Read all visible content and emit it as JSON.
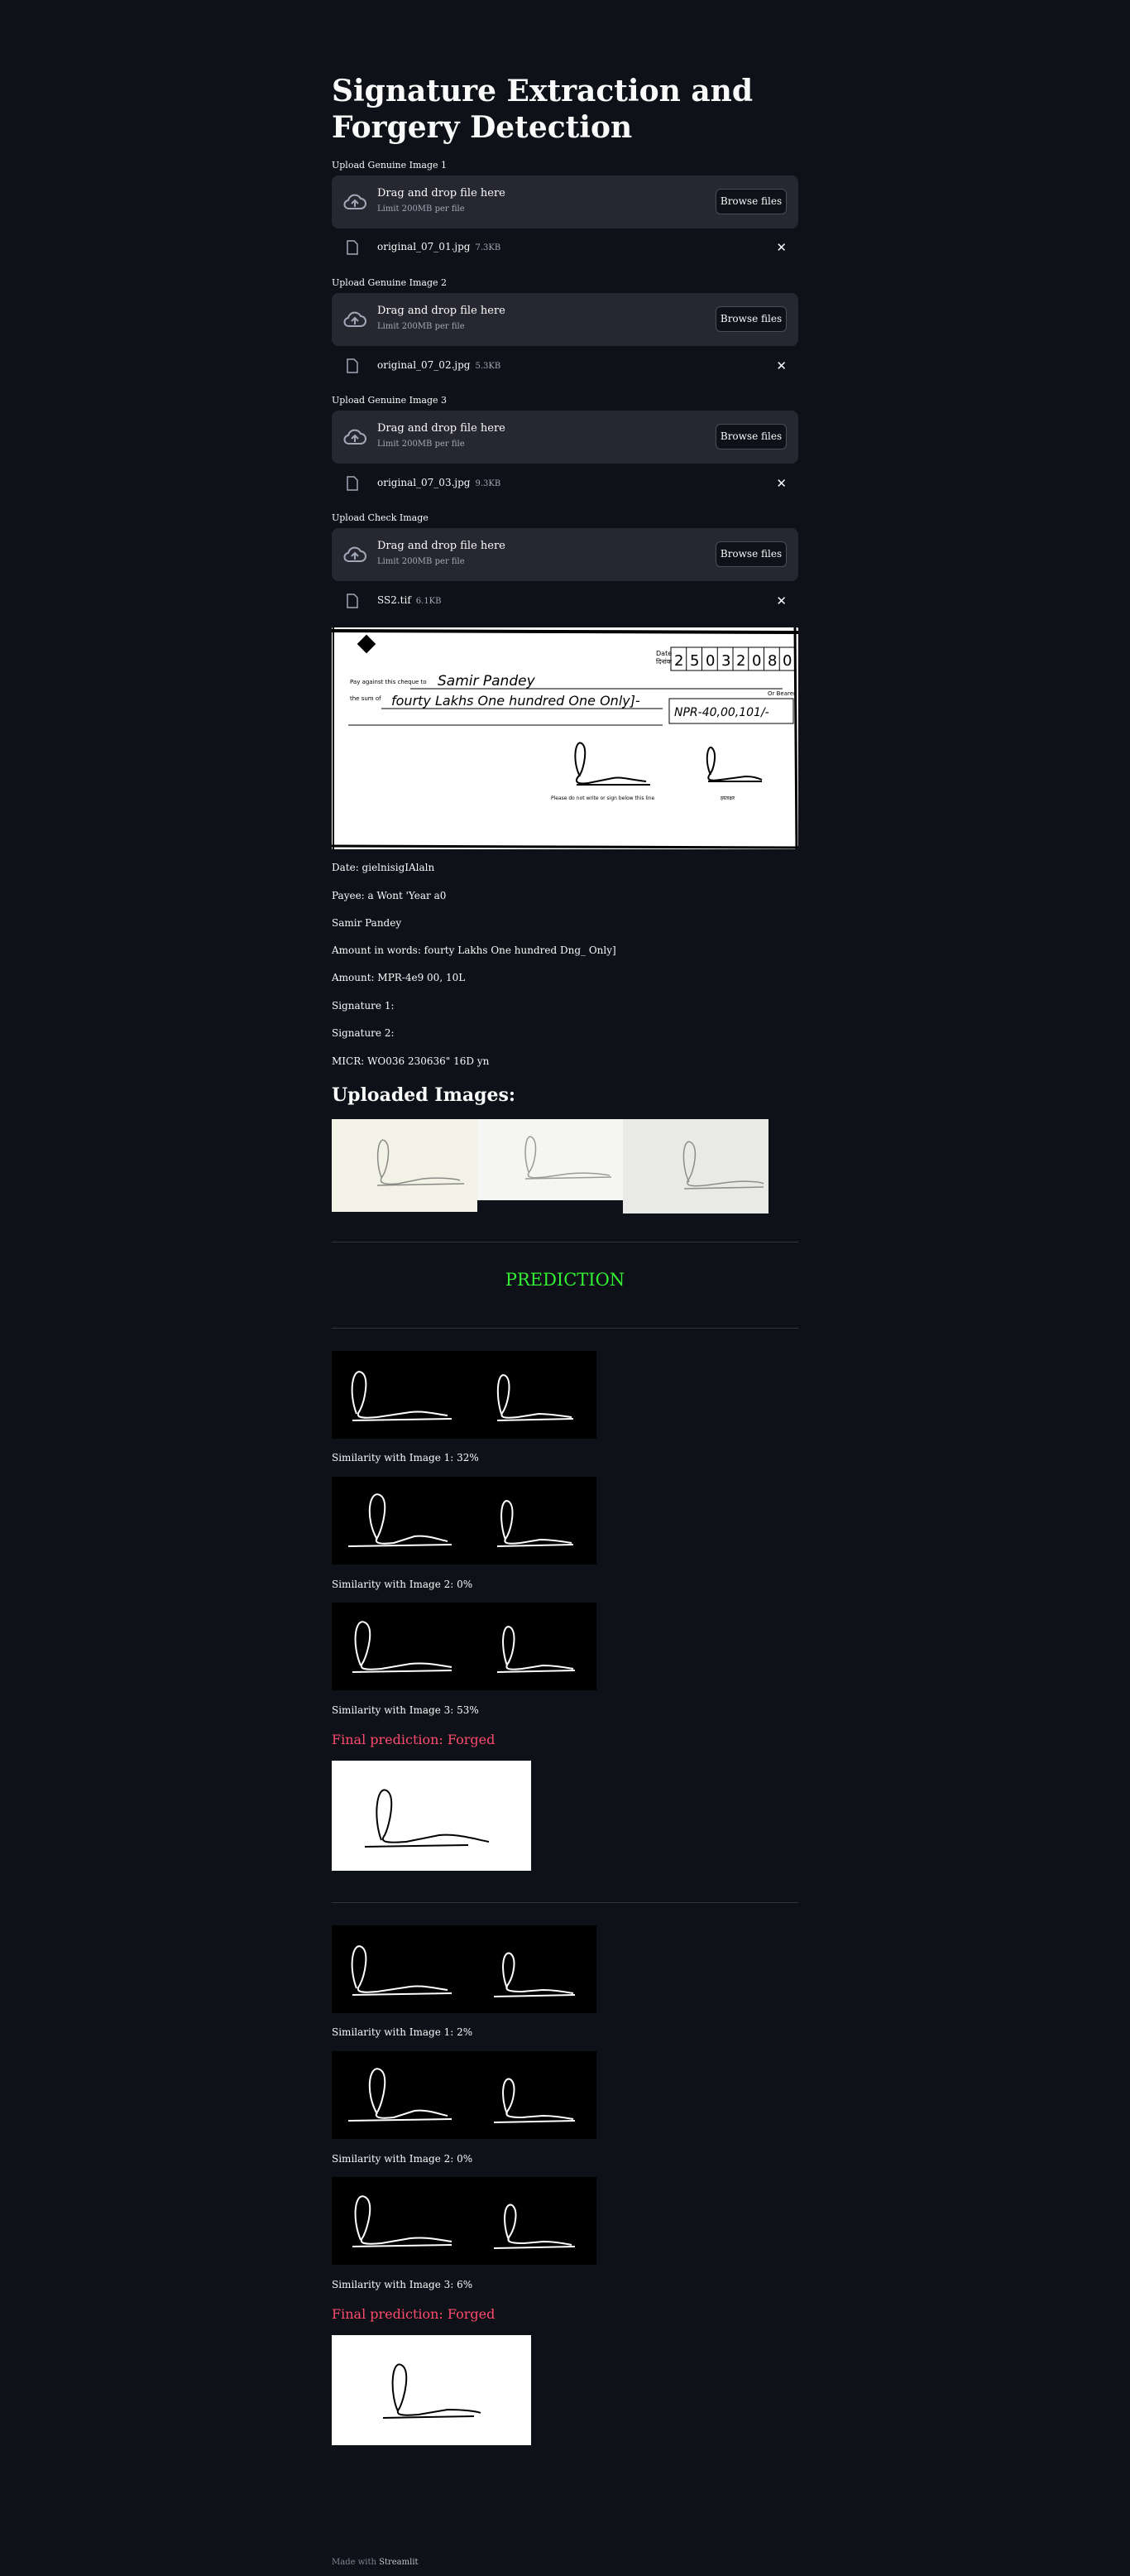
{
  "app": {
    "title": "Signature Extraction and Forgery Detection"
  },
  "uploaders": [
    {
      "label": "Upload Genuine Image 1",
      "drop_text": "Drag and drop file here",
      "limit": "Limit 200MB per file",
      "button": "Browse files",
      "file_name": "original_07_01.jpg",
      "file_size": "7.3KB"
    },
    {
      "label": "Upload Genuine Image 2",
      "drop_text": "Drag and drop file here",
      "limit": "Limit 200MB per file",
      "button": "Browse files",
      "file_name": "original_07_02.jpg",
      "file_size": "5.3KB"
    },
    {
      "label": "Upload Genuine Image 3",
      "drop_text": "Drag and drop file here",
      "limit": "Limit 200MB per file",
      "button": "Browse files",
      "file_name": "original_07_03.jpg",
      "file_size": "9.3KB"
    },
    {
      "label": "Upload Check Image",
      "drop_text": "Drag and drop file here",
      "limit": "Limit 200MB per file",
      "button": "Browse files",
      "file_name": "SS2.tif",
      "file_size": "6.1KB"
    }
  ],
  "cheque": {
    "date_label_1": "Date",
    "date_label_2": "दिनांक",
    "date_digits": [
      "2",
      "5",
      "0",
      "3",
      "2",
      "0",
      "8",
      "0"
    ],
    "pay_line": "Pay against this cheque to",
    "payee_handwritten": "Samir Pandey",
    "or_bearer": "Or Bearer",
    "sum_label": "the sum of",
    "sum_handwritten": "fourty Lakhs One hundred One Only]-",
    "amount_box": "NPR-40,00,101/-",
    "sign_note_1": "Please do not write or sign below this line",
    "sign_note_2": "हस्ताक्षर"
  },
  "extracted": {
    "date": "Date: gielnisigIAlaln",
    "payee": "Payee: a Wont 'Year a0",
    "name": "Samir Pandey",
    "amount_words": "Amount in words: fourty Lakhs One hundred Dng_ Only]",
    "amount": "Amount: MPR-4e9 00, 10L",
    "signature1": "Signature 1:",
    "signature2": "Signature 2:",
    "micr": "MICR: WO036 230636\" 16D yn"
  },
  "uploaded_heading": "Uploaded Images:",
  "prediction_heading": "PREDICTION",
  "results": [
    {
      "sims": [
        "Similarity with Image 1: 32%",
        "Similarity with Image 2: 0%",
        "Similarity with Image 3: 53%"
      ],
      "final": "Final prediction: Forged"
    },
    {
      "sims": [
        "Similarity with Image 1: 2%",
        "Similarity with Image 2: 0%",
        "Similarity with Image 3: 6%"
      ],
      "final": "Final prediction: Forged"
    }
  ],
  "footer": {
    "prefix": "Made with ",
    "brand": "Streamlit"
  },
  "colors": {
    "background": "#0e1117",
    "panel": "#262730",
    "prediction": "#33ee33",
    "forged": "#ff4b6e"
  }
}
